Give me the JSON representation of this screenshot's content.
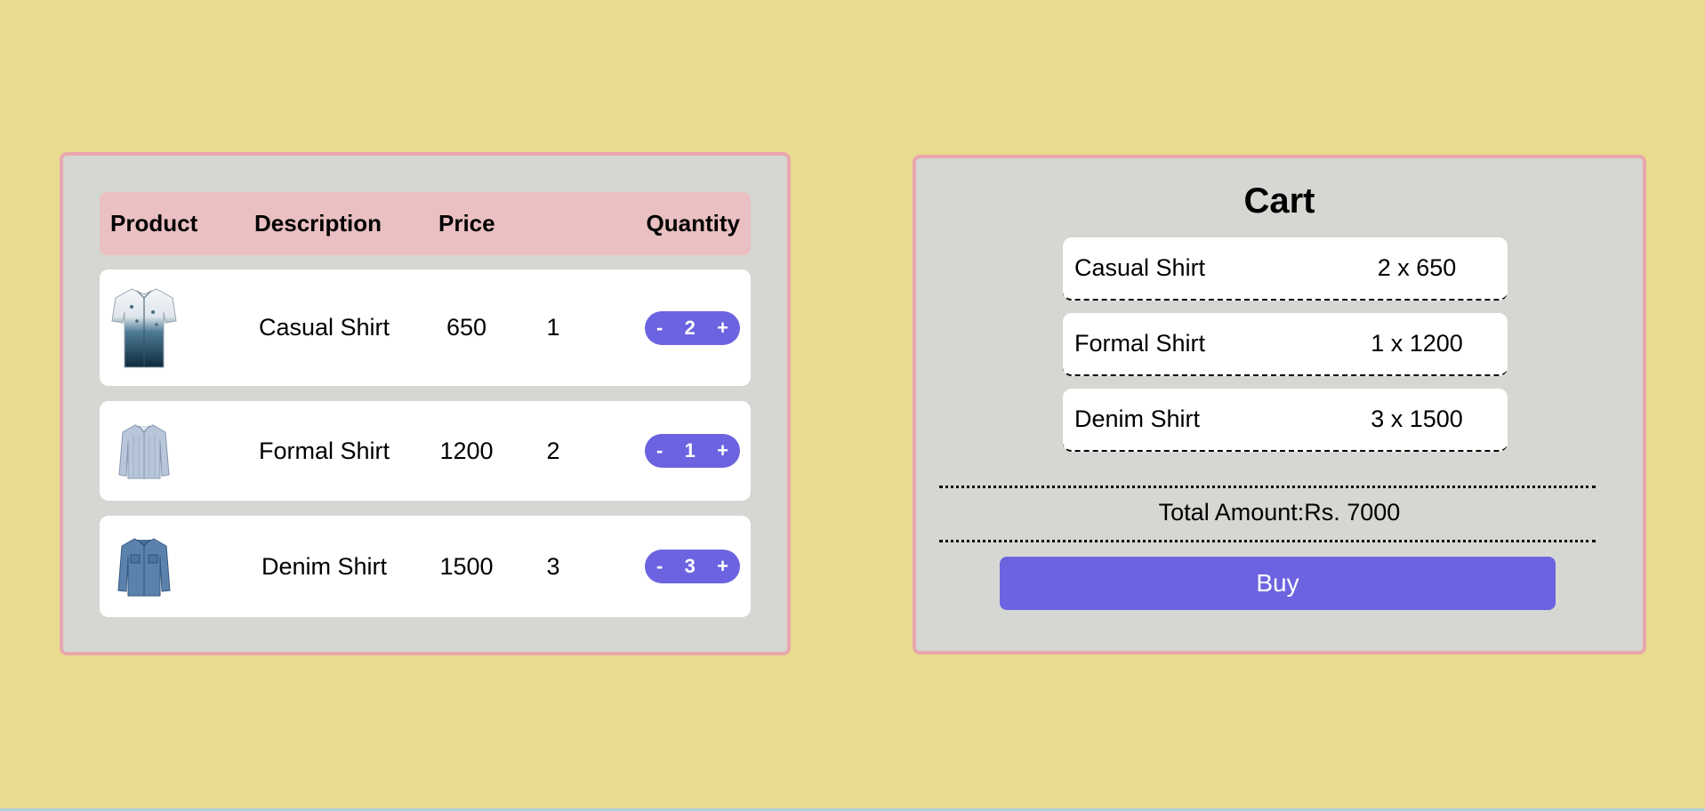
{
  "products": {
    "headers": {
      "product": "Product",
      "description": "Description",
      "price": "Price",
      "quantity": "Quantity"
    },
    "rows": [
      {
        "image": "casual-shirt-image",
        "description": "Casual Shirt",
        "price": "650",
        "qty": "1",
        "stepper": {
          "minus": "-",
          "value": "2",
          "plus": "+"
        }
      },
      {
        "image": "formal-shirt-image",
        "description": "Formal Shirt",
        "price": "1200",
        "qty": "2",
        "stepper": {
          "minus": "-",
          "value": "1",
          "plus": "+"
        }
      },
      {
        "image": "denim-shirt-image",
        "description": "Denim Shirt",
        "price": "1500",
        "qty": "3",
        "stepper": {
          "minus": "-",
          "value": "3",
          "plus": "+"
        }
      }
    ]
  },
  "cart": {
    "title": "Cart",
    "items": [
      {
        "name": "Casual Shirt",
        "amount": "2 x 650"
      },
      {
        "name": "Formal Shirt",
        "amount": "1 x 1200"
      },
      {
        "name": "Denim Shirt",
        "amount": "3 x 1500"
      }
    ],
    "total": "Total Amount:Rs. 7000",
    "buy_label": "Buy"
  },
  "colors": {
    "background": "#eadc8f",
    "panel": "#d5d7d3",
    "panel_border": "#e9a8ad",
    "header": "#eac0c2",
    "accent": "#6c63e0"
  }
}
